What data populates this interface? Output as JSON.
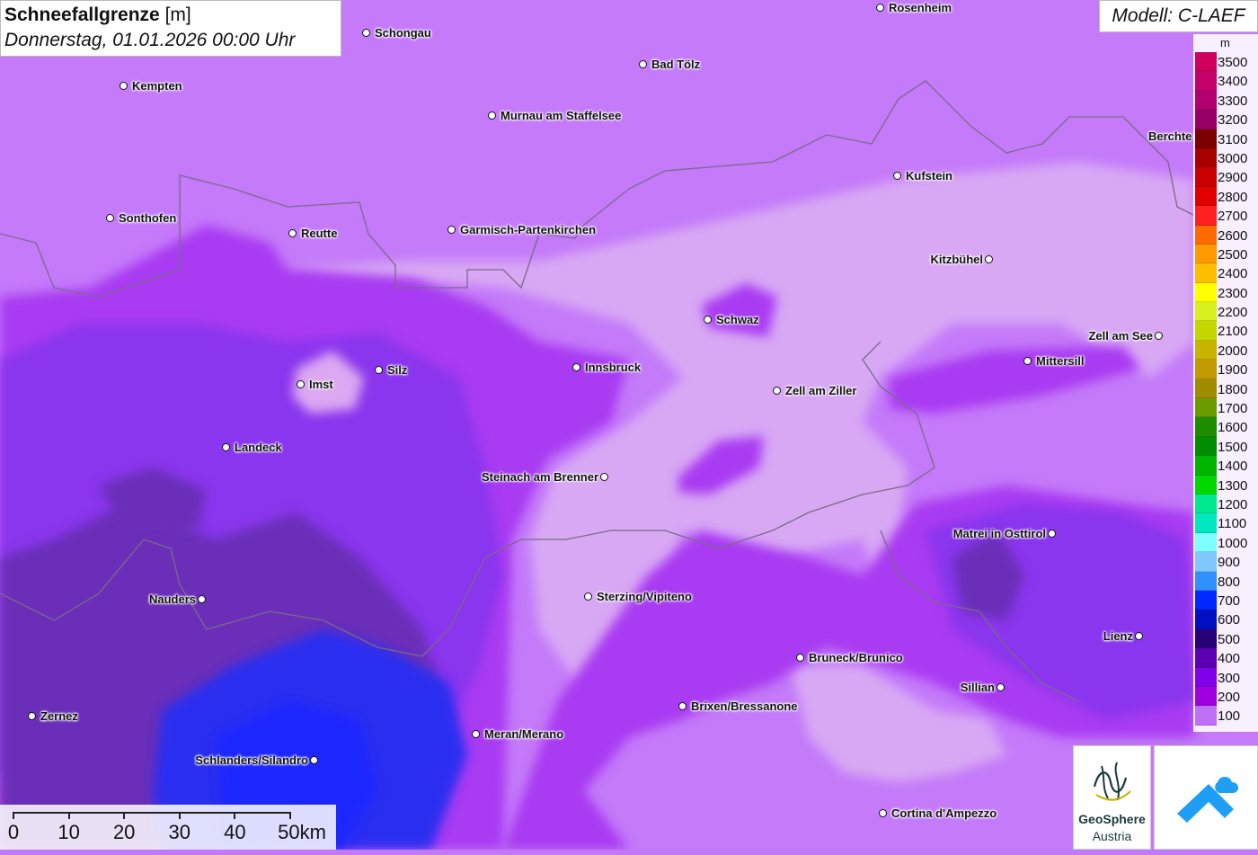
{
  "title": {
    "name": "Schneefallgrenze",
    "unit": "[m]",
    "datetime": "Donnerstag, 01.01.2026 00:00 Uhr"
  },
  "model": "Modell: C-LAEF",
  "legend": {
    "unit": "m",
    "entries": [
      {
        "label": "3500",
        "color": "#d0005e"
      },
      {
        "label": "3400",
        "color": "#c4006a"
      },
      {
        "label": "3300",
        "color": "#b00070"
      },
      {
        "label": "3200",
        "color": "#960064"
      },
      {
        "label": "3100",
        "color": "#7a0000"
      },
      {
        "label": "3000",
        "color": "#a80000"
      },
      {
        "label": "2900",
        "color": "#c80000"
      },
      {
        "label": "2800",
        "color": "#e00000"
      },
      {
        "label": "2700",
        "color": "#ff2020"
      },
      {
        "label": "2600",
        "color": "#ff6a00"
      },
      {
        "label": "2500",
        "color": "#ff9a00"
      },
      {
        "label": "2400",
        "color": "#ffbe00"
      },
      {
        "label": "2300",
        "color": "#ffff00"
      },
      {
        "label": "2200",
        "color": "#d8f020"
      },
      {
        "label": "2100",
        "color": "#c4d800"
      },
      {
        "label": "2000",
        "color": "#c8b400"
      },
      {
        "label": "1900",
        "color": "#c09a00"
      },
      {
        "label": "1800",
        "color": "#a08c00"
      },
      {
        "label": "1700",
        "color": "#6a9a00"
      },
      {
        "label": "1600",
        "color": "#1e8c00"
      },
      {
        "label": "1500",
        "color": "#008c00"
      },
      {
        "label": "1400",
        "color": "#00b400"
      },
      {
        "label": "1300",
        "color": "#00d800"
      },
      {
        "label": "1200",
        "color": "#00e890"
      },
      {
        "label": "1100",
        "color": "#00e8c0"
      },
      {
        "label": "1000",
        "color": "#80ffff"
      },
      {
        "label": "900",
        "color": "#80c8ff"
      },
      {
        "label": "800",
        "color": "#3090ff"
      },
      {
        "label": "700",
        "color": "#0028ff"
      },
      {
        "label": "600",
        "color": "#0010c0"
      },
      {
        "label": "500",
        "color": "#280078"
      },
      {
        "label": "400",
        "color": "#5a00b0"
      },
      {
        "label": "300",
        "color": "#8000e8"
      },
      {
        "label": "200",
        "color": "#a000e0"
      },
      {
        "label": "100",
        "color": "#c070f8"
      }
    ]
  },
  "scale": {
    "labels": [
      "0",
      "10",
      "20",
      "30",
      "40",
      "50km"
    ]
  },
  "logos": {
    "geosphere_line1": "GeoSphere",
    "geosphere_line2": "Austria"
  },
  "cities": [
    {
      "name": "Rosenheim",
      "side": "right"
    },
    {
      "name": "Schongau",
      "side": "right"
    },
    {
      "name": "Bad Tölz",
      "side": "right"
    },
    {
      "name": "Kempten",
      "side": "right"
    },
    {
      "name": "Murnau am Staffelsee",
      "side": "right"
    },
    {
      "name": "Berchte",
      "side": "left"
    },
    {
      "name": "Kufstein",
      "side": "right"
    },
    {
      "name": "Sonthofen",
      "side": "right"
    },
    {
      "name": "Reutte",
      "side": "right"
    },
    {
      "name": "Garmisch-Partenkirchen",
      "side": "right"
    },
    {
      "name": "Kitzbühel",
      "side": "left"
    },
    {
      "name": "Schwaz",
      "side": "right"
    },
    {
      "name": "Zell am See",
      "side": "left"
    },
    {
      "name": "Mittersill",
      "side": "right"
    },
    {
      "name": "Innsbruck",
      "side": "right"
    },
    {
      "name": "Silz",
      "side": "right"
    },
    {
      "name": "Imst",
      "side": "right"
    },
    {
      "name": "Zell am Ziller",
      "side": "right"
    },
    {
      "name": "Landeck",
      "side": "right"
    },
    {
      "name": "Steinach am Brenner",
      "side": "left"
    },
    {
      "name": "Matrei in Osttirol",
      "side": "left"
    },
    {
      "name": "Nauders",
      "side": "left"
    },
    {
      "name": "Sterzing/Vipiteno",
      "side": "right"
    },
    {
      "name": "Lienz",
      "side": "left"
    },
    {
      "name": "Bruneck/Brunico",
      "side": "right"
    },
    {
      "name": "Sillian",
      "side": "left"
    },
    {
      "name": "Brixen/Bressanone",
      "side": "right"
    },
    {
      "name": "Zernez",
      "side": "right"
    },
    {
      "name": "Meran/Merano",
      "side": "right"
    },
    {
      "name": "Schlanders/Silandro",
      "side": "left"
    },
    {
      "name": "Cortina d'Ampezzo",
      "side": "right"
    }
  ]
}
